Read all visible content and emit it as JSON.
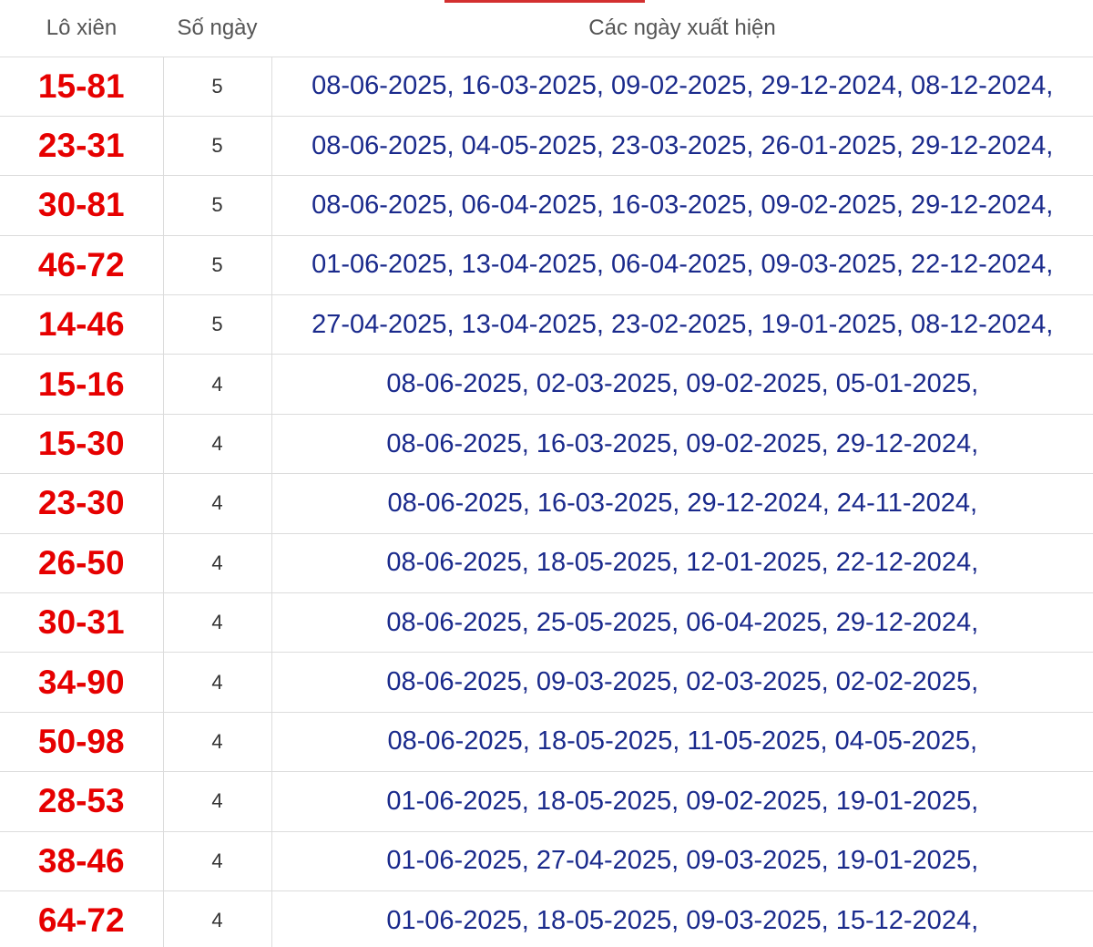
{
  "table": {
    "headers": [
      "Lô xiên",
      "Số ngày",
      "Các ngày xuất hiện"
    ],
    "accent_color": "#d32f2f",
    "colors": {
      "pair": "#e60000",
      "dates": "#1a2a8c",
      "header": "#555555"
    },
    "rows": [
      {
        "pair": "15-81",
        "count": "5",
        "dates": "08-06-2025, 16-03-2025, 09-02-2025, 29-12-2024, 08-12-2024,"
      },
      {
        "pair": "23-31",
        "count": "5",
        "dates": "08-06-2025, 04-05-2025, 23-03-2025, 26-01-2025, 29-12-2024,"
      },
      {
        "pair": "30-81",
        "count": "5",
        "dates": "08-06-2025, 06-04-2025, 16-03-2025, 09-02-2025, 29-12-2024,"
      },
      {
        "pair": "46-72",
        "count": "5",
        "dates": "01-06-2025, 13-04-2025, 06-04-2025, 09-03-2025, 22-12-2024,"
      },
      {
        "pair": "14-46",
        "count": "5",
        "dates": "27-04-2025, 13-04-2025, 23-02-2025, 19-01-2025, 08-12-2024,"
      },
      {
        "pair": "15-16",
        "count": "4",
        "dates": "08-06-2025, 02-03-2025, 09-02-2025, 05-01-2025,"
      },
      {
        "pair": "15-30",
        "count": "4",
        "dates": "08-06-2025, 16-03-2025, 09-02-2025, 29-12-2024,"
      },
      {
        "pair": "23-30",
        "count": "4",
        "dates": "08-06-2025, 16-03-2025, 29-12-2024, 24-11-2024,"
      },
      {
        "pair": "26-50",
        "count": "4",
        "dates": "08-06-2025, 18-05-2025, 12-01-2025, 22-12-2024,"
      },
      {
        "pair": "30-31",
        "count": "4",
        "dates": "08-06-2025, 25-05-2025, 06-04-2025, 29-12-2024,"
      },
      {
        "pair": "34-90",
        "count": "4",
        "dates": "08-06-2025, 09-03-2025, 02-03-2025, 02-02-2025,"
      },
      {
        "pair": "50-98",
        "count": "4",
        "dates": "08-06-2025, 18-05-2025, 11-05-2025, 04-05-2025,"
      },
      {
        "pair": "28-53",
        "count": "4",
        "dates": "01-06-2025, 18-05-2025, 09-02-2025, 19-01-2025,"
      },
      {
        "pair": "38-46",
        "count": "4",
        "dates": "01-06-2025, 27-04-2025, 09-03-2025, 19-01-2025,"
      },
      {
        "pair": "64-72",
        "count": "4",
        "dates": "01-06-2025, 18-05-2025, 09-03-2025, 15-12-2024,"
      }
    ]
  }
}
